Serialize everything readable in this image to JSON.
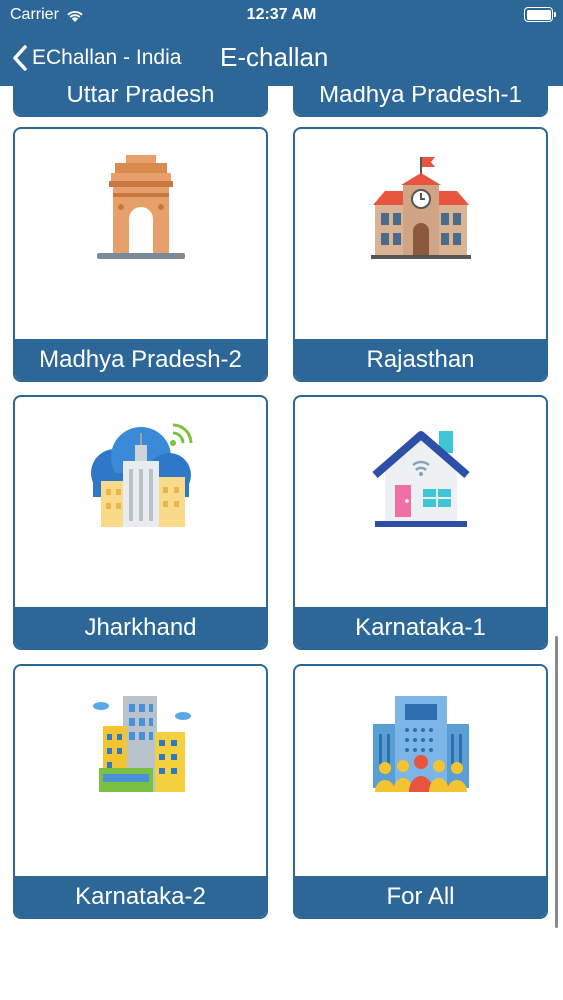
{
  "status_bar": {
    "carrier": "Carrier",
    "time": "12:37 AM"
  },
  "nav": {
    "back_label": "EChallan - India",
    "title": "E-challan"
  },
  "states": [
    {
      "label": "Uttar Pradesh",
      "icon": "building-icon"
    },
    {
      "label": "Madhya Pradesh-1",
      "icon": "building-icon"
    },
    {
      "label": "Madhya Pradesh-2",
      "icon": "india-gate-icon"
    },
    {
      "label": "Rajasthan",
      "icon": "school-building-icon"
    },
    {
      "label": "Jharkhand",
      "icon": "smart-city-cloud-icon"
    },
    {
      "label": "Karnataka-1",
      "icon": "smart-home-icon"
    },
    {
      "label": "Karnataka-2",
      "icon": "city-buildings-icon"
    },
    {
      "label": "For All",
      "icon": "office-people-icon"
    }
  ],
  "colors": {
    "header": "#2c6797",
    "card_border": "#2c6797",
    "label_bg": "#2c6797"
  }
}
